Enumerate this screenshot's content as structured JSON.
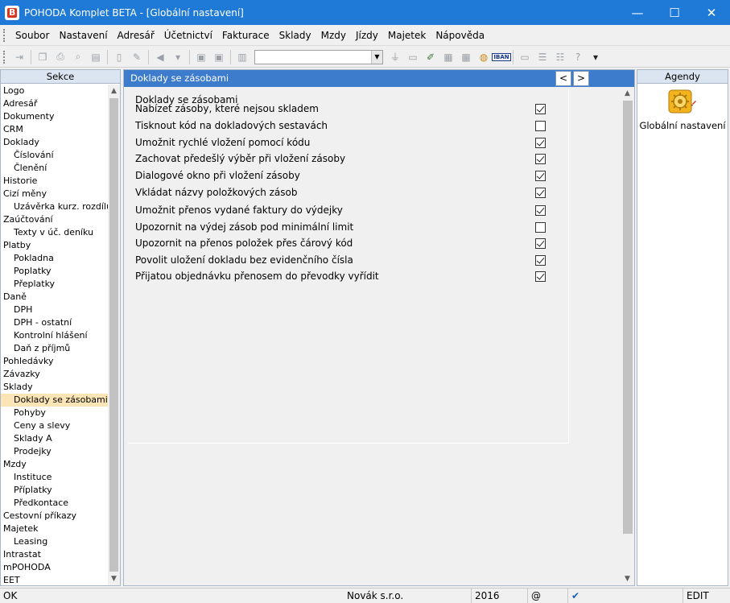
{
  "window": {
    "title": "POHODA Komplet BETA - [Globální nastavení]",
    "minimize": "—",
    "maximize": "☐",
    "close": "✕"
  },
  "menu": {
    "items": [
      "Soubor",
      "Nastavení",
      "Adresář",
      "Účetnictví",
      "Fakturace",
      "Sklady",
      "Mzdy",
      "Jízdy",
      "Majetek",
      "Nápověda"
    ]
  },
  "toolbar": {
    "combo_value": "",
    "iban_label": "IBAN"
  },
  "left": {
    "header": "Sekce",
    "items": [
      {
        "label": "Logo",
        "sub": false
      },
      {
        "label": "Adresář",
        "sub": false
      },
      {
        "label": "Dokumenty",
        "sub": false
      },
      {
        "label": "CRM",
        "sub": false
      },
      {
        "label": "Doklady",
        "sub": false
      },
      {
        "label": "Číslování",
        "sub": true
      },
      {
        "label": "Členění",
        "sub": true
      },
      {
        "label": "Historie",
        "sub": false
      },
      {
        "label": "Cizí měny",
        "sub": false
      },
      {
        "label": "Uzávěrka kurz. rozdílů",
        "sub": true
      },
      {
        "label": "Zaúčtování",
        "sub": false
      },
      {
        "label": "Texty v úč. deníku",
        "sub": true
      },
      {
        "label": "Platby",
        "sub": false
      },
      {
        "label": "Pokladna",
        "sub": true
      },
      {
        "label": "Poplatky",
        "sub": true
      },
      {
        "label": "Přeplatky",
        "sub": true
      },
      {
        "label": "Daně",
        "sub": false
      },
      {
        "label": "DPH",
        "sub": true
      },
      {
        "label": "DPH - ostatní",
        "sub": true
      },
      {
        "label": "Kontrolní hlášení",
        "sub": true
      },
      {
        "label": "Daň z příjmů",
        "sub": true
      },
      {
        "label": "Pohledávky",
        "sub": false
      },
      {
        "label": "Závazky",
        "sub": false
      },
      {
        "label": "Sklady",
        "sub": false
      },
      {
        "label": "Doklady se zásobami",
        "sub": true
      },
      {
        "label": "Pohyby",
        "sub": true
      },
      {
        "label": "Ceny a slevy",
        "sub": true
      },
      {
        "label": "Sklady A",
        "sub": true
      },
      {
        "label": "Prodejky",
        "sub": true
      },
      {
        "label": "Mzdy",
        "sub": false
      },
      {
        "label": "Instituce",
        "sub": true
      },
      {
        "label": "Příplatky",
        "sub": true
      },
      {
        "label": "Předkontace",
        "sub": true
      },
      {
        "label": "Cestovní příkazy",
        "sub": false
      },
      {
        "label": "Majetek",
        "sub": false
      },
      {
        "label": "Leasing",
        "sub": true
      },
      {
        "label": "Intrastat",
        "sub": false
      },
      {
        "label": "mPOHODA",
        "sub": false
      },
      {
        "label": "EET",
        "sub": false
      }
    ],
    "selected": "Doklady se zásobami"
  },
  "middle": {
    "header": "Doklady se zásobami",
    "nav_prev": "<",
    "nav_next": ">",
    "section_title": "Doklady se zásobami",
    "options": [
      {
        "label": "Nabízet zásoby, které nejsou skladem",
        "checked": true
      },
      {
        "label": "Tisknout kód na dokladových sestavách",
        "checked": false
      },
      {
        "label": "Umožnit rychlé vložení pomocí kódu",
        "checked": true
      },
      {
        "label": "Zachovat předešlý výběr při vložení zásoby",
        "checked": true
      },
      {
        "label": "Dialogové okno při vložení zásoby",
        "checked": true
      },
      {
        "label": "Vkládat názvy položkových zásob",
        "checked": true
      },
      {
        "label": "Umožnit přenos vydané faktury do výdejky",
        "checked": true
      },
      {
        "label": "Upozornit na výdej zásob pod minimální limit",
        "checked": false
      },
      {
        "label": "Upozornit na přenos položek přes čárový kód",
        "checked": true
      },
      {
        "label": "Povolit uložení dokladu bez evidenčního čísla",
        "checked": true
      },
      {
        "label": "Přijatou objednávku přenosem do převodky vyřídit",
        "checked": true
      }
    ]
  },
  "right": {
    "header": "Agendy",
    "agenda_label": "Globální nastavení"
  },
  "status": {
    "ok": "OK",
    "company": "Novák s.r.o.",
    "year": "2016",
    "at": "@",
    "check": "✔",
    "mode": "EDIT"
  }
}
